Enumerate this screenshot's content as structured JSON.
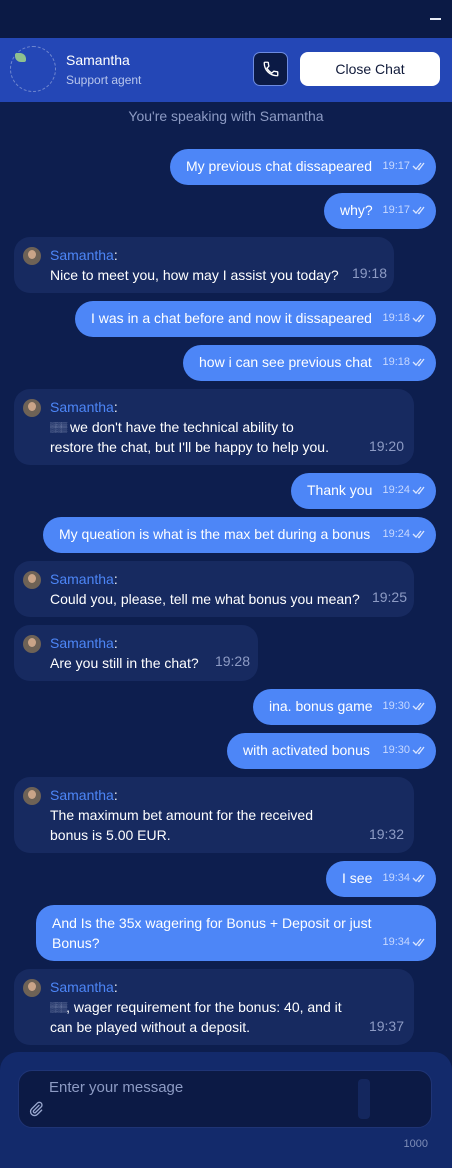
{
  "header": {
    "agent_name": "Samantha",
    "agent_role": "Support agent",
    "close_label": "Close Chat",
    "accent": "#2447b6"
  },
  "notice": "You're speaking with Samantha",
  "messages": [
    {
      "from": "user",
      "text": "My previous chat dissapeared",
      "time": "19:17"
    },
    {
      "from": "user",
      "text": "why?",
      "time": "19:17"
    },
    {
      "from": "agent",
      "name": "Samantha",
      "text": "Nice to meet you, how may I assist you today?",
      "time": "19:18"
    },
    {
      "from": "user",
      "text": "I was in a chat before and now it dissapeared",
      "time": "19:18"
    },
    {
      "from": "user",
      "text": "how i can see previous chat",
      "time": "19:18"
    },
    {
      "from": "agent",
      "name": "Samantha",
      "line1": "we don't have the technical ability to",
      "line2": "restore the chat, but I'll be happy to help you.",
      "time": "19:20"
    },
    {
      "from": "user",
      "text": "Thank you",
      "time": "19:24"
    },
    {
      "from": "user",
      "text": "My queation is what is the max bet during a bonus",
      "time": "19:24"
    },
    {
      "from": "agent",
      "name": "Samantha",
      "text": "Could you, please, tell me what bonus you mean?",
      "time": "19:25"
    },
    {
      "from": "agent",
      "name": "Samantha",
      "text": "Are you still in the chat?",
      "time": "19:28"
    },
    {
      "from": "user",
      "text": "ina. bonus game",
      "time": "19:30"
    },
    {
      "from": "user",
      "text": "with activated bonus",
      "time": "19:30"
    },
    {
      "from": "agent",
      "name": "Samantha",
      "line1": "The maximum bet amount for the received",
      "line2": "bonus is 5.00 EUR.",
      "time": "19:32"
    },
    {
      "from": "user",
      "text": "I see",
      "time": "19:34"
    },
    {
      "from": "user",
      "line1": "And Is the 35x wagering for Bonus + Deposit or just",
      "line2": "Bonus?",
      "time": "19:34"
    },
    {
      "from": "agent",
      "name": "Samantha",
      "line1": ", wager requirement for the bonus: 40, and it",
      "line2": "can be played without a deposit.",
      "time": "19:37"
    }
  ],
  "composer": {
    "placeholder": "Enter your message",
    "counter": "1000"
  }
}
